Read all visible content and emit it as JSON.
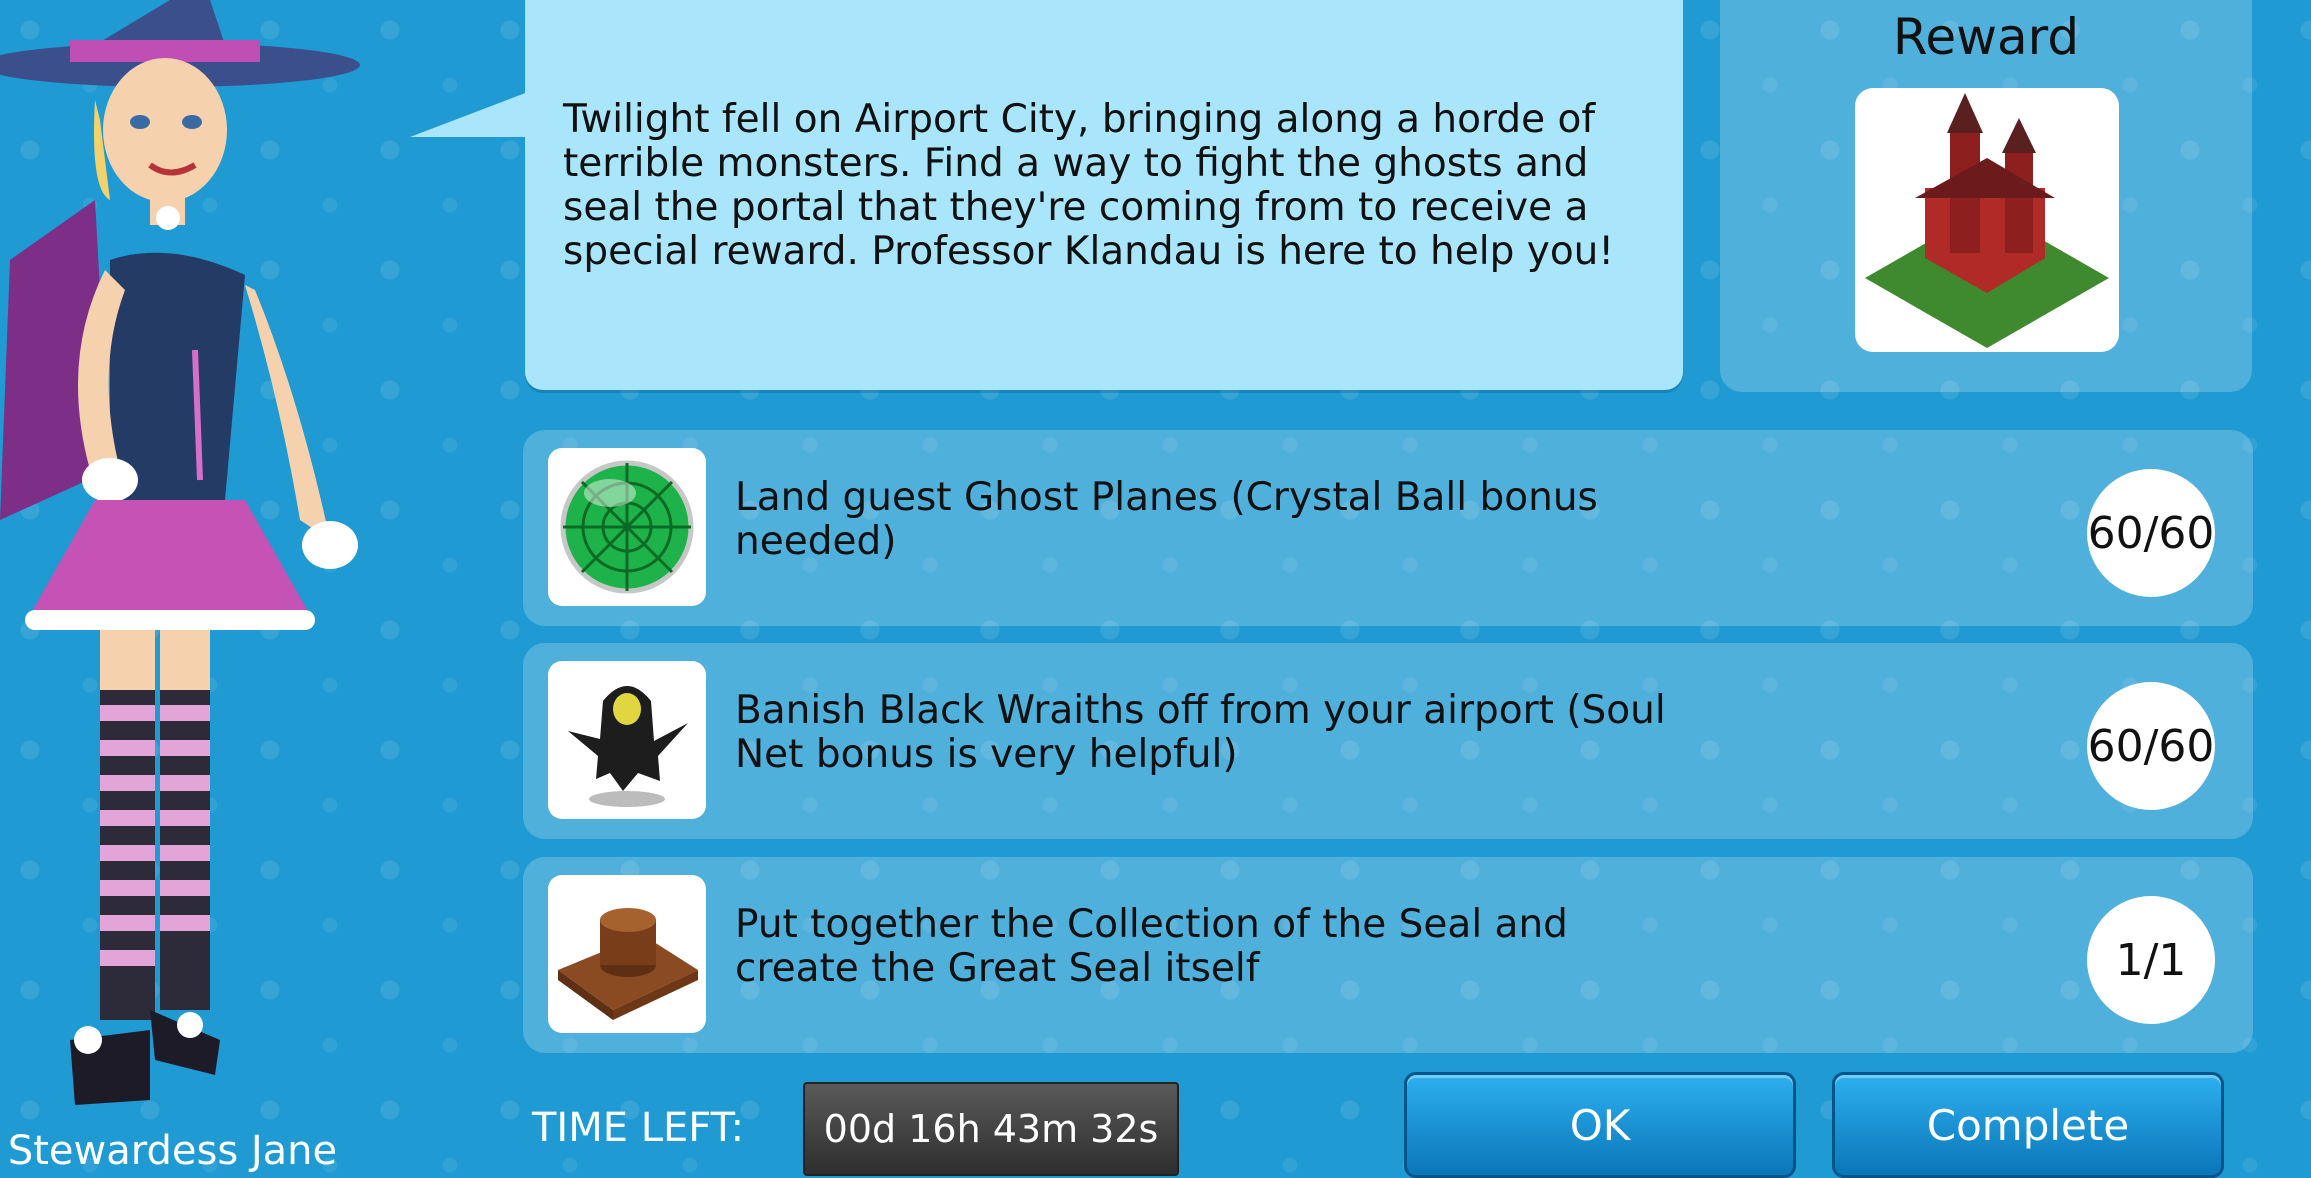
{
  "dialog": {
    "story_text": "Twilight fell on Airport City, bringing along a horde of terrible monsters. Find a way to fight the ghosts and seal the portal that they're coming from to receive a special reward. Professor Klandau is here to help you!",
    "reward_title": "Reward",
    "character_name": "Stewardess Jane"
  },
  "tasks": [
    {
      "icon": "crystal-ball-icon",
      "text": "Land guest Ghost Planes (Crystal Ball bonus needed)",
      "progress": "60/60"
    },
    {
      "icon": "black-wraith-icon",
      "text": "Banish Black Wraiths off from your airport (Soul Net bonus is very helpful)",
      "progress": "60/60"
    },
    {
      "icon": "great-seal-icon",
      "text": "Put together the Collection of the Seal and create the Great Seal itself",
      "progress": "1/1"
    }
  ],
  "footer": {
    "time_left_label": "TIME LEFT:",
    "time_left_value": "00d 16h 43m 32s",
    "ok_label": "OK",
    "complete_label": "Complete"
  },
  "colors": {
    "background": "#1f9ad3",
    "speech_bubble": "#a9e6fb",
    "button": "#1a94d8"
  }
}
